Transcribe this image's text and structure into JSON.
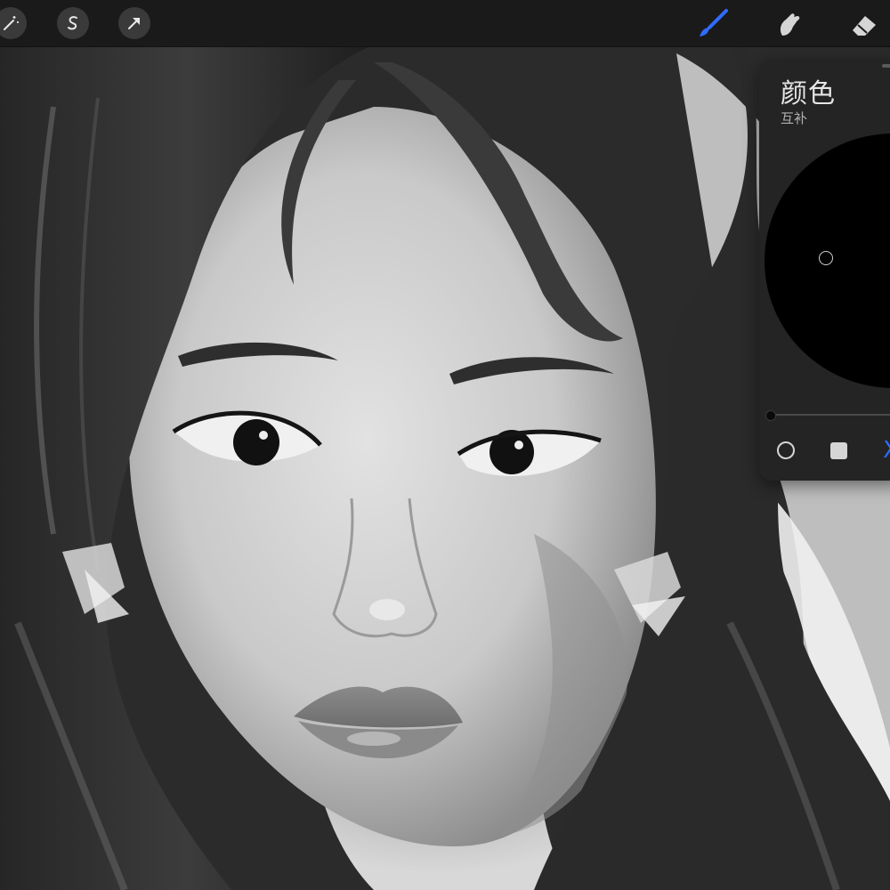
{
  "toolbar": {
    "left_tools": [
      {
        "icon": "adjustments-magic-wand-icon"
      },
      {
        "icon": "selection-s-icon"
      },
      {
        "icon": "transform-arrow-icon"
      }
    ],
    "right_tools": [
      {
        "icon": "brush-icon",
        "active": true
      },
      {
        "icon": "smudge-icon",
        "active": false
      },
      {
        "icon": "eraser-icon",
        "active": false
      }
    ],
    "accent_color": "#2f6bff"
  },
  "color_panel": {
    "title": "颜色",
    "subtitle": "互补",
    "current_color": "#000000",
    "mode_x_label": "X",
    "modes": [
      "disc",
      "classic",
      "harmony"
    ]
  }
}
